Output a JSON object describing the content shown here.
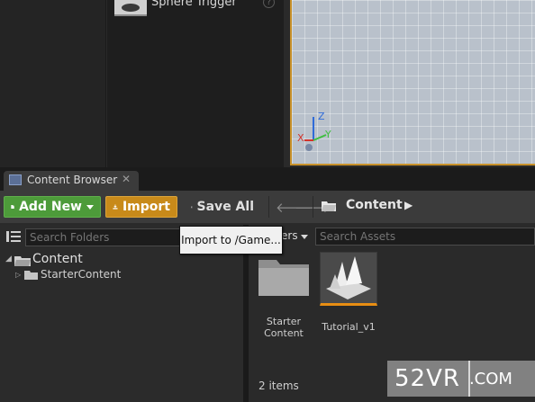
{
  "outliner": {
    "item_label": "Sphere Trigger",
    "help_glyph": "?"
  },
  "viewport": {
    "axis_labels": {
      "x": "X",
      "y": "Y",
      "z": "Z"
    },
    "axis_colors": {
      "x": "#d2342c",
      "y": "#3fbf3f",
      "z": "#2f6bd8"
    }
  },
  "tab": {
    "label": "Content Browser",
    "close_glyph": "✕"
  },
  "toolbar": {
    "add_new_label": "Add New",
    "import_label": "Import",
    "save_all_label": "Save All",
    "back_glyph": "🡐",
    "forward_glyph": "🡒",
    "path_label": "Content",
    "path_arrow_glyph": "▶",
    "accent_green": "#4d9b3a",
    "accent_orange": "#c88a1a"
  },
  "folders": {
    "search_placeholder": "Search Folders",
    "tree": [
      {
        "label": "Content",
        "expanded": true
      },
      {
        "label": "StarterContent",
        "expanded": false
      }
    ]
  },
  "assets": {
    "filters_label": "ers",
    "search_placeholder": "Search Assets",
    "items": [
      {
        "label": "Starter Content",
        "icon": "folder-icon"
      },
      {
        "label": "Tutorial_v1",
        "icon": "map-thumbnail-icon"
      }
    ],
    "count_label": "2 items",
    "selection_color": "#e88e13"
  },
  "tooltip": {
    "text": "Import to /Game..."
  },
  "watermark": {
    "brand": "52VR",
    "suffix": ".COM"
  }
}
